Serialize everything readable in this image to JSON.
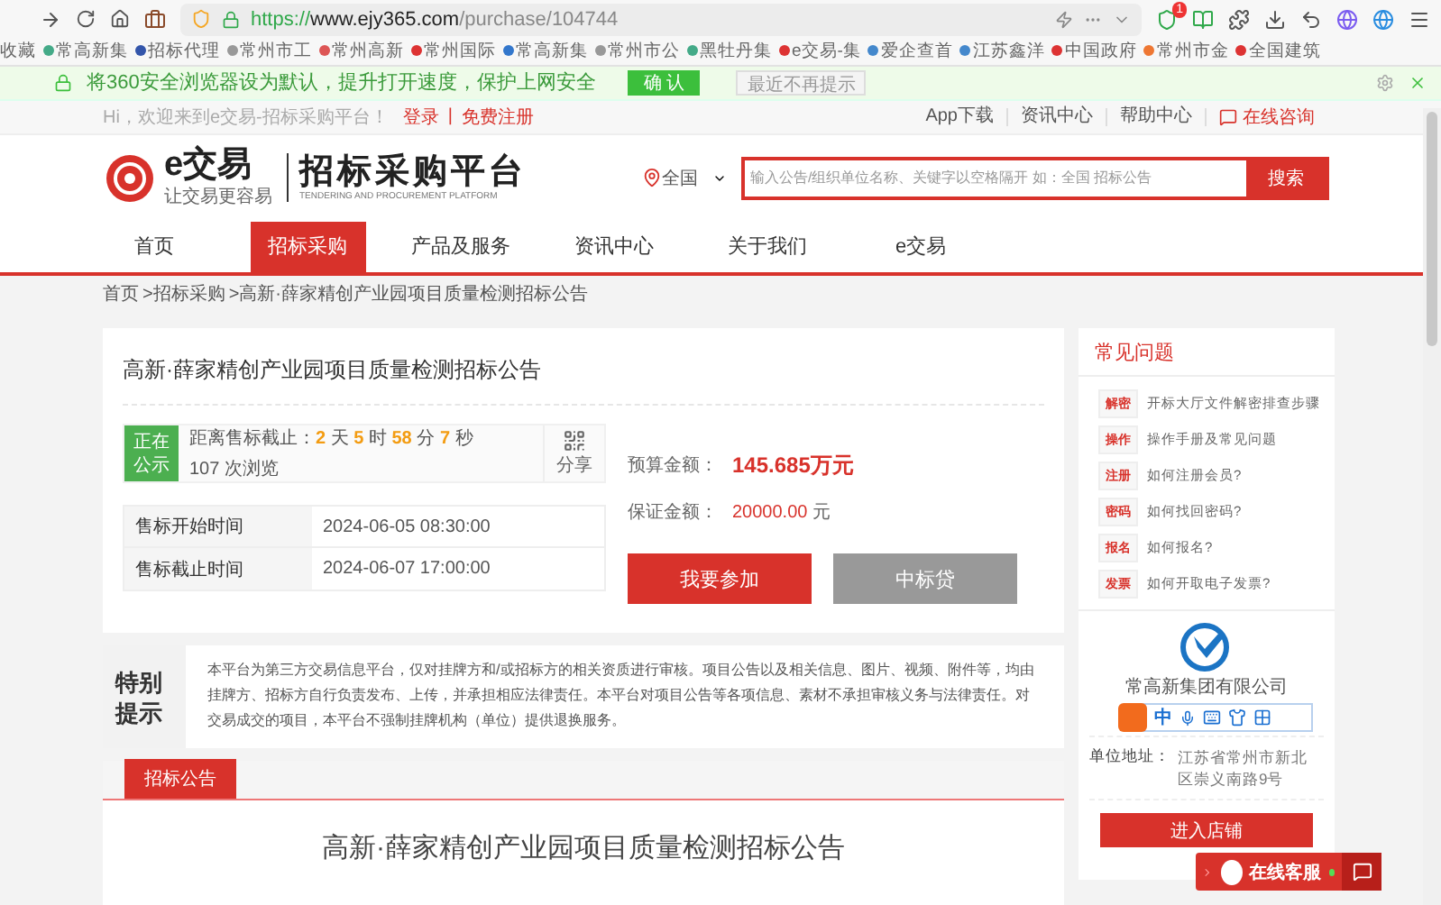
{
  "browser": {
    "url_scheme": "https://",
    "url_host": "www.ejy365.com",
    "url_path": "/purchase/104744",
    "badge": "1"
  },
  "bookmarks": [
    {
      "label": "收藏"
    },
    {
      "label": "常高新集"
    },
    {
      "label": "招标代理"
    },
    {
      "label": "常州市工"
    },
    {
      "label": "常州高新"
    },
    {
      "label": "常州国际"
    },
    {
      "label": "常高新集"
    },
    {
      "label": "常州市公"
    },
    {
      "label": "黑牡丹集"
    },
    {
      "label": "e交易-集"
    },
    {
      "label": "爱企查首"
    },
    {
      "label": "江苏鑫洋"
    },
    {
      "label": "中国政府"
    },
    {
      "label": "常州市金"
    },
    {
      "label": "全国建筑"
    }
  ],
  "infobar": {
    "message": "将360安全浏览器设为默认，提升打开速度，保护上网安全",
    "confirm": "确 认",
    "dismiss": "最近不再提示"
  },
  "topbar": {
    "welcome": "Hi，欢迎来到e交易-招标采购平台！",
    "login": "登录",
    "separator": "|",
    "register": "免费注册",
    "links": [
      "App下载",
      "资讯中心",
      "帮助中心"
    ],
    "consult": "在线咨询"
  },
  "header": {
    "logo_mark": "e交易",
    "logo_slogan": "让交易更容易",
    "platform_title": "招标采购平台",
    "platform_subtitle": "TENDERING AND PROCUREMENT PLATFORM",
    "region": "全国",
    "search_placeholder": "输入公告/组织单位名称、关键字以空格隔开 如：全国 招标公告",
    "search_button": "搜索"
  },
  "nav": [
    {
      "label": "首页",
      "selected": false
    },
    {
      "label": "招标采购",
      "selected": true
    },
    {
      "label": "产品及服务",
      "selected": false
    },
    {
      "label": "资讯中心",
      "selected": false
    },
    {
      "label": "关于我们",
      "selected": false
    },
    {
      "label": "e交易",
      "selected": false
    }
  ],
  "breadcrumb": [
    "首页",
    ">招标采购",
    ">高新·薛家精创产业园项目质量检测招标公告"
  ],
  "project": {
    "title": "高新·薛家精创产业园项目质量检测招标公告",
    "status": "正在公示",
    "countdown_label": "距离售标截止：",
    "countdown": [
      {
        "value": "2",
        "unit": "天"
      },
      {
        "value": "5",
        "unit": "时"
      },
      {
        "value": "58",
        "unit": "分"
      },
      {
        "value": "7",
        "unit": "秒"
      }
    ],
    "views": "107 次浏览",
    "share": "分享",
    "times": [
      {
        "label": "售标开始时间",
        "value": "2024-06-05 08:30:00"
      },
      {
        "label": "售标截止时间",
        "value": "2024-06-07 17:00:00"
      }
    ],
    "budget_label": "预算金额：",
    "budget": "145.685万元",
    "deposit_label": "保证金额：",
    "deposit": "20000.00",
    "deposit_unit": "元",
    "join": "我要参加",
    "loan": "中标贷"
  },
  "notice": {
    "title": "特别提示",
    "text": "本平台为第三方交易信息平台，仅对挂牌方和/或招标方的相关资质进行审核。项目公告以及相关信息、图片、视频、附件等，均由挂牌方、招标方自行负责发布、上传，并承担相应法律责任。本平台对项目公告等各项信息、素材不承担审核义务与法律责任。对交易成交的项目，本平台不强制挂牌机构（单位）提供退换服务。"
  },
  "tabs": [
    {
      "label": "招标公告",
      "selected": true
    }
  ],
  "announcement_title": "高新·薛家精创产业园项目质量检测招标公告",
  "faq": {
    "title": "常见问题",
    "items": [
      {
        "tag": "解密",
        "text": "开标大厅文件解密排查步骤"
      },
      {
        "tag": "操作",
        "text": "操作手册及常见问题"
      },
      {
        "tag": "注册",
        "text": "如何注册会员?"
      },
      {
        "tag": "密码",
        "text": "如何找回密码?"
      },
      {
        "tag": "报名",
        "text": "如何报名?"
      },
      {
        "tag": "发票",
        "text": "如何开取电子发票?"
      }
    ]
  },
  "company": {
    "name": "常高新集团有限公司",
    "address_label": "单位地址：",
    "address": "江苏省常州市新北区崇义南路9号",
    "enter": "进入店铺"
  },
  "ime": {
    "mode": "中"
  },
  "chat": {
    "label": "在线客服"
  }
}
